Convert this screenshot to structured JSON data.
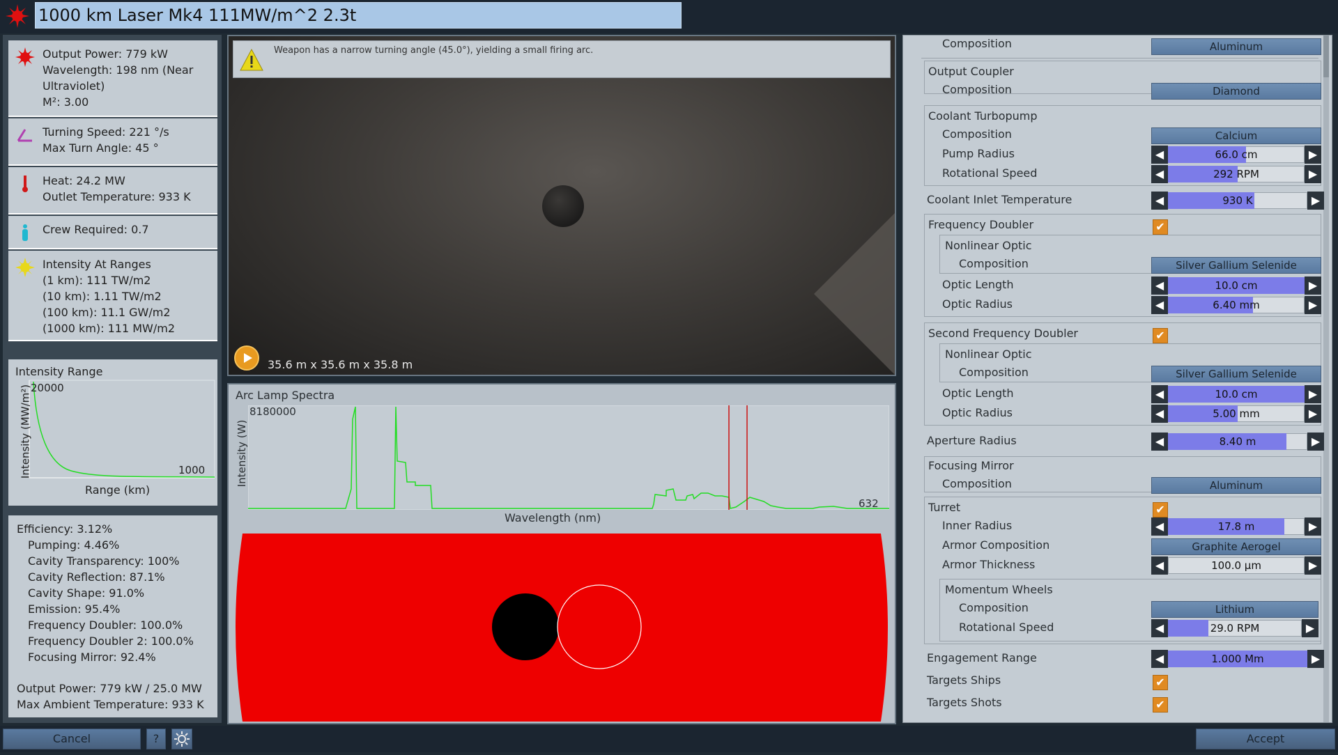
{
  "title": "1000 km Laser Mk4 111MW/m^2 2.3t",
  "stats": {
    "laser": [
      "Output Power: 779 kW",
      "Wavelength: 198 nm (Near",
      "Ultraviolet)",
      "M²: 3.00"
    ],
    "turning": [
      "Turning Speed: 221 °/s",
      "Max Turn Angle: 45 °"
    ],
    "heat": [
      "Heat: 24.2 MW",
      "Outlet Temperature: 933 K"
    ],
    "crew": [
      "Crew Required: 0.7"
    ],
    "intensity": [
      "Intensity At Ranges",
      "(1 km): 111 TW/m2",
      "(10 km): 1.11 TW/m2",
      "(100 km): 11.1 GW/m2",
      "(1000 km): 111 MW/m2"
    ]
  },
  "intensity_chart": {
    "title": "Intensity Range",
    "ylabel": "Intensity (MW/m²)",
    "xlabel": "Range (km)",
    "ymax_label": "20000",
    "xmax_label": "1000"
  },
  "efficiency": {
    "header": "Efficiency: 3.12%",
    "items": [
      "Pumping: 4.46%",
      "Cavity Transparency: 100%",
      "Cavity Reflection: 87.1%",
      "Cavity Shape: 91.0%",
      "Emission: 95.4%",
      "Frequency Doubler: 100.0%",
      "Frequency Doubler 2: 100.0%",
      "Focusing Mirror: 92.4%"
    ],
    "footer": [
      "Output Power: 779 kW / 25.0 MW",
      "Max Ambient Temperature: 933 K"
    ]
  },
  "viewport": {
    "warning": "Weapon has a narrow turning angle (45.0°), yielding a small firing arc.",
    "dimensions": "35.6 m x 35.6 m x 35.8 m"
  },
  "spectra": {
    "title": "Arc Lamp Spectra",
    "ylabel": "Intensity (W)",
    "xlabel": "Wavelength (nm)",
    "ymax_label": "8180000",
    "xmax_label": "632"
  },
  "right": {
    "rows": {
      "top_composition_label": "Composition",
      "top_composition_value": "Aluminum",
      "output_coupler": "Output Coupler",
      "oc_composition_label": "Composition",
      "oc_composition_value": "Diamond",
      "coolant_turbopump": "Coolant Turbopump",
      "ct_composition_label": "Composition",
      "ct_composition_value": "Calcium",
      "pump_radius_label": "Pump Radius",
      "pump_radius_value": "66.0 cm",
      "rot_speed_label": "Rotational Speed",
      "rot_speed_value": "292 RPM",
      "coolant_inlet_label": "Coolant Inlet Temperature",
      "coolant_inlet_value": "930 K",
      "freq_doubler": "Frequency Doubler",
      "nonlinear_optic": "Nonlinear Optic",
      "fd_composition_label": "Composition",
      "fd_composition_value": "Silver Gallium Selenide",
      "optic_length_label": "Optic Length",
      "optic_length_value": "10.0 cm",
      "optic_radius_label": "Optic Radius",
      "optic_radius_value": "6.40 mm",
      "second_freq_doubler": "Second Frequency Doubler",
      "nonlinear_optic2": "Nonlinear Optic",
      "sfd_composition_label": "Composition",
      "sfd_composition_value": "Silver Gallium Selenide",
      "optic_length2_label": "Optic Length",
      "optic_length2_value": "10.0 cm",
      "optic_radius2_label": "Optic Radius",
      "optic_radius2_value": "5.00 mm",
      "aperture_label": "Aperture Radius",
      "aperture_value": "8.40 m",
      "focusing_mirror": "Focusing Mirror",
      "fm_composition_label": "Composition",
      "fm_composition_value": "Aluminum",
      "turret": "Turret",
      "inner_radius_label": "Inner Radius",
      "inner_radius_value": "17.8 m",
      "armor_comp_label": "Armor Composition",
      "armor_comp_value": "Graphite Aerogel",
      "armor_thick_label": "Armor Thickness",
      "armor_thick_value": "100.0 µm",
      "momentum_wheels": "Momentum Wheels",
      "mw_composition_label": "Composition",
      "mw_composition_value": "Lithium",
      "mw_rot_label": "Rotational Speed",
      "mw_rot_value": "29.0 RPM",
      "engagement_label": "Engagement Range",
      "engagement_value": "1.000 Mm",
      "targets_ships": "Targets Ships",
      "targets_shots": "Targets Shots"
    },
    "slider_levels": {
      "pump_radius": 0.57,
      "rot_speed": 0.51,
      "coolant_inlet": 0.62,
      "optic_length": 1.0,
      "optic_radius": 0.62,
      "optic_length2": 1.0,
      "optic_radius2": 0.51,
      "aperture": 0.85,
      "inner_radius": 0.85,
      "armor_thick": 0.0,
      "mw_rot": 0.3,
      "engagement": 1.0
    }
  },
  "buttons": {
    "cancel": "Cancel",
    "help": "?",
    "accept": "Accept"
  },
  "colors": {
    "slider_fill": "#7c7ce8",
    "checkbox": "#e08a22",
    "spectra_line": "#22dd22",
    "marker_line": "#cc1111",
    "lens_red": "#ee0000"
  }
}
